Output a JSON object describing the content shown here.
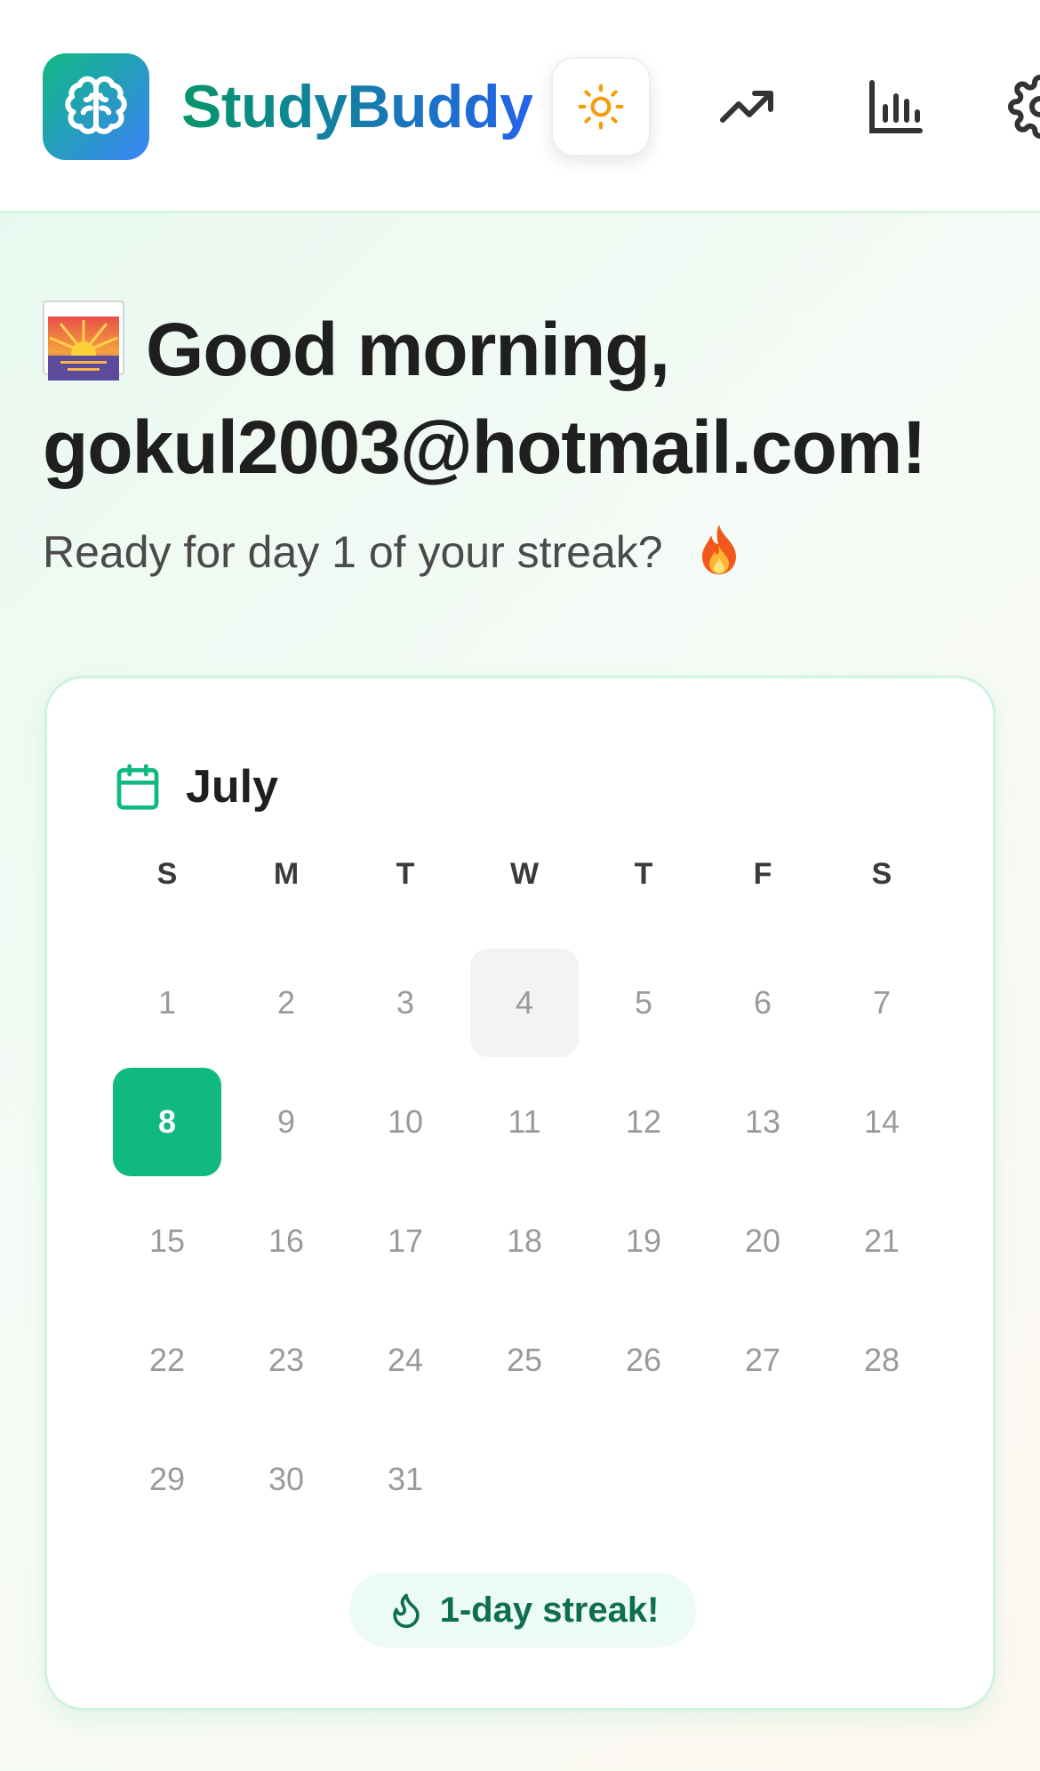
{
  "header": {
    "brand": "StudyBuddy",
    "logo_icon": "brain-icon",
    "theme_icon": "sun-icon",
    "nav": [
      {
        "name": "trending-icon"
      },
      {
        "name": "bar-chart-icon"
      },
      {
        "name": "gear-icon"
      }
    ]
  },
  "greeting": {
    "emoji": "sunrise-emoji",
    "title": "Good morning, gokul2003@hotmail.com!",
    "subtitle": "Ready for day 1 of your streak?",
    "subtitle_emoji": "fire-emoji"
  },
  "calendar": {
    "month": "July",
    "weekdays": [
      "S",
      "M",
      "T",
      "W",
      "T",
      "F",
      "S"
    ],
    "days": [
      "1",
      "2",
      "3",
      "4",
      "5",
      "6",
      "7",
      "8",
      "9",
      "10",
      "11",
      "12",
      "13",
      "14",
      "15",
      "16",
      "17",
      "18",
      "19",
      "20",
      "21",
      "22",
      "23",
      "24",
      "25",
      "26",
      "27",
      "28",
      "29",
      "30",
      "31"
    ],
    "today": "8",
    "highlighted": "4",
    "streak_label": "1-day streak!"
  },
  "colors": {
    "accent": "#10b981",
    "brand_gradient_start": "#059669",
    "brand_gradient_end": "#2563eb",
    "sun": "#f59e0b"
  }
}
